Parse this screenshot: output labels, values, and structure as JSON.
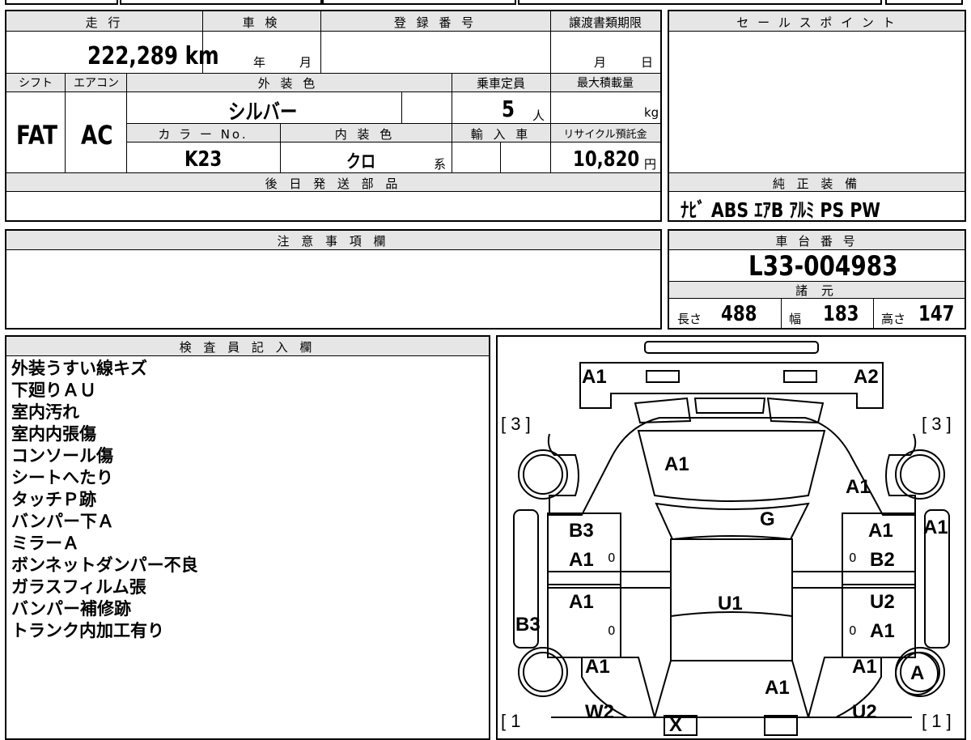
{
  "sheet": {
    "mileage_label": "走 行",
    "shaken_label": "車 検",
    "reg_no_label": "登 録 番 号",
    "transfer_deadline_label": "譲渡書類期限",
    "mileage_value": "222,289 km",
    "year_unit": "年",
    "month_unit": "月",
    "deadline_month": "月",
    "deadline_day": "日",
    "shift_label": "シフト",
    "ac_label": "エアコン",
    "ext_color_label": "外 装 色",
    "capacity_label": "乗車定員",
    "max_load_label": "最大積載量",
    "shift_value": "FAT",
    "ac_value": "AC",
    "ext_color_value": "シルバー",
    "capacity_value": "5",
    "capacity_unit": "人",
    "max_load_unit": "kg",
    "color_no_label": "カ ラ ー No.",
    "int_color_label": "内 装 色",
    "import_label": "輸 入 車",
    "recycle_label": "リサイクル預託金",
    "color_no_value": "K23",
    "int_color_value": "クロ",
    "int_color_suffix": "系",
    "recycle_value": "10,820",
    "recycle_unit": "円",
    "parts_label": "後 日 発 送 部 品",
    "sales_point_label": "セ ー ル ス ポ イ ン ト",
    "genuine_equip_label": "純 正 装 備",
    "genuine_equip_value": "ﾅﾋﾞ ABS ｴｱB ｱﾙﾐ PS PW",
    "caution_label": "注 意 事 項 欄",
    "chassis_label": "車 台 番 号",
    "chassis_value": "L33-004983",
    "specs_label": "諸 元",
    "length_label": "長さ",
    "length_value": "488",
    "width_label": "幅",
    "width_value": "183",
    "height_label": "高さ",
    "height_value": "147",
    "inspector_label": "検 査 員 記 入 欄",
    "inspector_notes": [
      "外装うすい線キズ",
      "下廻りＡＵ",
      "室内汚れ",
      "室内内張傷",
      "コンソール傷",
      "シートへたり",
      "タッチＰ跡",
      "バンパー下Ａ",
      "ミラーＡ",
      "ボンネットダンパー不良",
      "ガラスフィルム張",
      "バンパー補修跡",
      "トランク内加工有り"
    ]
  },
  "diagram": {
    "tire_front_left": "[ 3 ]",
    "tire_front_right": "[ 3 ]",
    "tire_rear_left": "[ 1",
    "tire_rear_right": "[ 1 ]",
    "marks": {
      "front_bumper_left": "A1",
      "front_bumper_right": "A2",
      "hood": "A1",
      "front_fender_right": "A1",
      "windshield": "G",
      "front_door_left_top": "B3",
      "front_door_left": "A1",
      "front_door_right_top": "A1",
      "front_door_right": "B2",
      "mirror_right": "A1",
      "roof": "U1",
      "rear_door_left": "A1",
      "rear_door_right_top": "U2",
      "rear_door_right": "A1",
      "rocker_left": "B3",
      "rear_fender_left": "A1",
      "rear_fender_right": "A1",
      "trunk": "A1",
      "rear_wheel_right": "A",
      "rear_bumper_left": "W2",
      "rear_bumper_right": "U2",
      "rear_bumper_center": "X",
      "zero_mark": "0"
    }
  }
}
